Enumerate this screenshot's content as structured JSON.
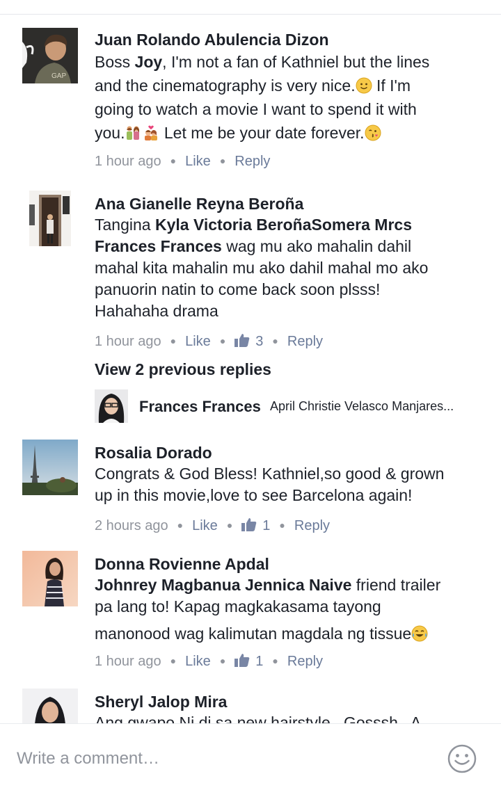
{
  "composer": {
    "placeholder": "Write a comment…",
    "emoji_icon": "smiley-icon"
  },
  "comments": [
    {
      "author": "Juan Rolando Abulencia Dizon",
      "line1_pre": "Boss ",
      "line1_mention": "Joy",
      "line1_post": ", I'm not a fan of Kathniel but the lines",
      "line2": "and the cinematography is very nice.",
      "line2_post": " If I'm",
      "line3": "going to watch a movie I want to spend it with",
      "line4_pre": "you.",
      "line4_post": " Let me be your date forever.",
      "time": "1 hour ago",
      "like": "Like",
      "reply": "Reply",
      "emojis": [
        "slight-smile-icon",
        "couple-icon",
        "kiss-couple-icon",
        "blow-kiss-icon"
      ]
    },
    {
      "author": "Ana Gianelle Reyna Beroña",
      "line1_pre": "Tangina ",
      "line1_mention": "Kyla Victoria BeroñaSomera Mrcs",
      "line2_mention": "Frances Frances",
      "line2_post": " wag mu ako mahalin dahil",
      "line3": "mahal kita mahalin mu ako dahil mahal mo ako",
      "line4": "panuorin natin to come back soon plsss!",
      "line5": "Hahahaha drama",
      "time": "1 hour ago",
      "like": "Like",
      "likes_count": "3",
      "reply": "Reply",
      "view_replies": "View 2 previous replies",
      "reply_preview": {
        "author": "Frances Frances",
        "snippet": "April Christie Velasco Manjares..."
      }
    },
    {
      "author": "Rosalia Dorado",
      "line1": "Congrats & God Bless! Kathniel,so good & grown",
      "line2": "up in this movie,love to see Barcelona again!",
      "time": "2 hours ago",
      "like": "Like",
      "likes_count": "1",
      "reply": "Reply"
    },
    {
      "author": "Donna Rovienne Apdal",
      "line1_mention": "Johnrey Magbanua Jennica Naive",
      "line1_post": " friend trailer",
      "line2": "pa lang to! Kapag magkakasama tayong",
      "line3": "manonood wag kalimutan magdala ng tissue ",
      "time": "1 hour ago",
      "like": "Like",
      "likes_count": "1",
      "reply": "Reply",
      "emojis": [
        "tears-of-joy-icon"
      ]
    },
    {
      "author": "Sheryl Jalop Mira",
      "line1": "Ang gwapo Ni di sa new hairstyle.. Gosssh.. A"
    }
  ]
}
